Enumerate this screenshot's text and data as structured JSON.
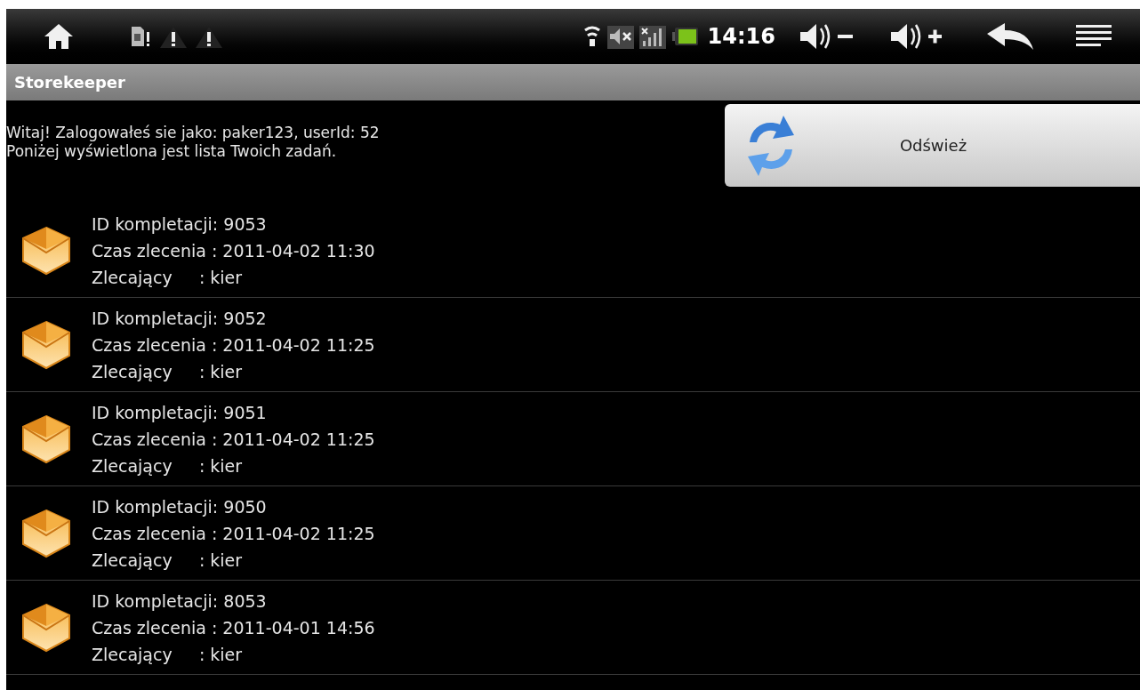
{
  "status_bar": {
    "time": "14:16"
  },
  "title_bar": {
    "title": "Storekeeper"
  },
  "welcome": [
    "Witaj! Zalogowałeś sie jako: paker123, userId: 52",
    "Poniżej wyświetlona jest lista Twoich zadań."
  ],
  "refresh_button": {
    "label": "Odśwież"
  },
  "tasks": [
    {
      "id": "ID kompletacji: 9053",
      "time": "Czas zlecenia : 2011-04-02 11:30",
      "requester": "Zlecający     : kier"
    },
    {
      "id": "ID kompletacji: 9052",
      "time": "Czas zlecenia : 2011-04-02 11:25",
      "requester": "Zlecający     : kier"
    },
    {
      "id": "ID kompletacji: 9051",
      "time": "Czas zlecenia : 2011-04-02 11:25",
      "requester": "Zlecający     : kier"
    },
    {
      "id": "ID kompletacji: 9050",
      "time": "Czas zlecenia : 2011-04-02 11:25",
      "requester": "Zlecający     : kier"
    },
    {
      "id": "ID kompletacji: 8053",
      "time": "Czas zlecenia : 2011-04-01 14:56",
      "requester": "Zlecający     : kier"
    }
  ]
}
